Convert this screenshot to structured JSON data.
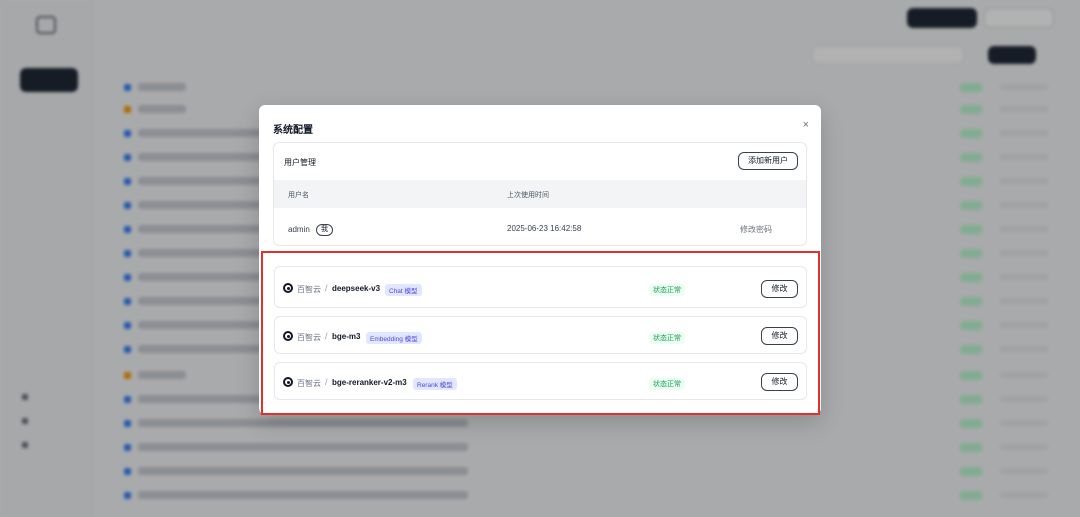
{
  "dialog": {
    "title": "系统配置",
    "close_icon": "×"
  },
  "user_management": {
    "title": "用户管理",
    "add_user_label": "添加新用户",
    "columns": [
      "用户名",
      "上次使用时间"
    ],
    "users": [
      {
        "name": "admin",
        "badge": "我",
        "last_used": "2025-06-23 16:42:58",
        "action_label": "修改密码"
      }
    ]
  },
  "models": [
    {
      "provider": "百智云",
      "separator": "/",
      "name": "deepseek-v3",
      "type_badge": "Chat 模型",
      "status": "状态正常",
      "edit_label": "修改"
    },
    {
      "provider": "百智云",
      "separator": "/",
      "name": "bge-m3",
      "type_badge": "Embedding 模型",
      "status": "状态正常",
      "edit_label": "修改"
    },
    {
      "provider": "百智云",
      "separator": "/",
      "name": "bge-reranker-v2-m3",
      "type_badge": "Rerank 模型",
      "status": "状态正常",
      "edit_label": "修改"
    }
  ],
  "colors": {
    "highlight": "#e0312b",
    "badge_bg": "#e0e7ff",
    "badge_text": "#4f46e5",
    "status_text": "#16a34a",
    "primary_dark": "#1f2937"
  }
}
